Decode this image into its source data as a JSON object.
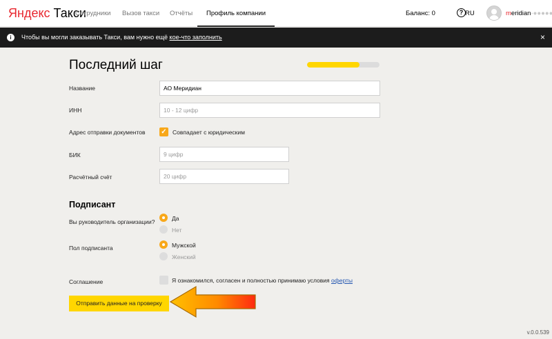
{
  "header": {
    "logo_brand": "Яндекс",
    "logo_product": "Такси",
    "nav": [
      "Сотрудники",
      "Вызов такси",
      "Отчёты",
      "Профиль компании"
    ],
    "balance": "Баланс: 0",
    "help_glyph": "?",
    "lang": "RU",
    "user_first": "m",
    "user_rest": "eridian",
    "user_fade": "-●●●●●"
  },
  "notice": {
    "info_glyph": "i",
    "text": "Чтобы вы могли заказывать Такси, вам нужно ещё ",
    "link": "кое-что заполнить",
    "close_glyph": "×"
  },
  "form": {
    "title": "Последний шаг",
    "progress_fraction": 0.72,
    "name_label": "Название",
    "name_value": "АО Меридиан",
    "inn_label": "ИНН",
    "inn_placeholder": "10 - 12 цифр",
    "address_label": "Адрес отправки документов",
    "address_check_label": "Совпадает с юридическим",
    "bik_label": "БИК",
    "bik_placeholder": "9 цифр",
    "account_label": "Расчётный счёт",
    "account_placeholder": "20 цифр",
    "check_glyph": "✓"
  },
  "signer": {
    "title": "Подписант",
    "director_label": "Вы руководитель организации?",
    "director_options": [
      "Да",
      "Нет"
    ],
    "gender_label": "Пол подписанта",
    "gender_options": [
      "Мужской",
      "Женский"
    ],
    "agreement_label": "Соглашение",
    "agreement_text": "Я ознакомился, согласен и полностью принимаю условия ",
    "agreement_link": "оферты",
    "submit_label": "Отправить данные на проверку"
  },
  "colors": {
    "accent_yellow": "#ffd600",
    "accent_orange": "#f8a81a",
    "brand_red": "#e8262e"
  },
  "version": "v.0.0.539"
}
